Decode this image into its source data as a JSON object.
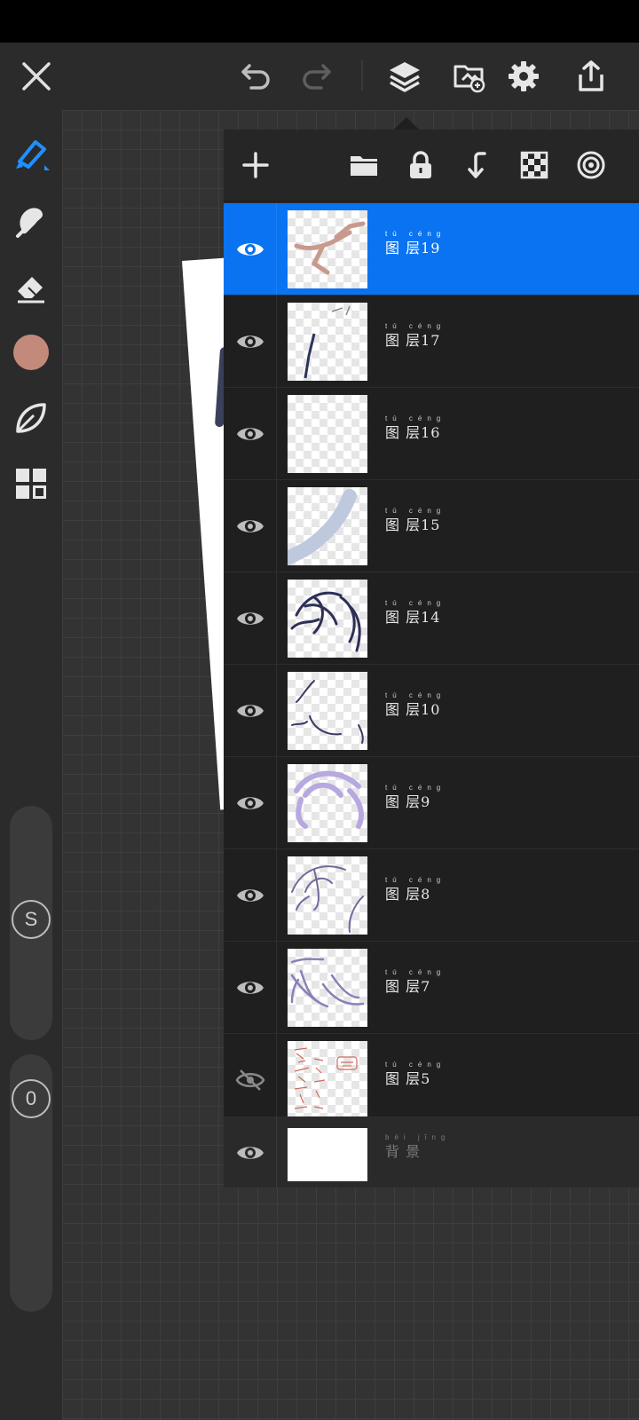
{
  "app": {
    "icons": {
      "close": "close-icon",
      "undo": "undo-icon",
      "redo": "redo-icon",
      "layers": "layers-icon",
      "import": "import-image-icon",
      "settings": "gear-icon",
      "share": "share-icon"
    }
  },
  "side_toolbar": {
    "tools": [
      "brush-icon",
      "smudge-icon",
      "eraser-icon",
      "color-swatch",
      "leaf-icon",
      "grid-icon"
    ],
    "color": "#c38a7c",
    "size_slider_label": "S",
    "opacity_slider_label": "0"
  },
  "layers_panel": {
    "toolbar": [
      "add-layer-icon",
      "folder-icon",
      "lock-icon",
      "merge-down-icon",
      "transparency-icon",
      "blend-mode-icon"
    ],
    "accent_color": "#0a73f2",
    "layers": [
      {
        "pinyin": "tú céng",
        "label": "图 层19",
        "visible": true,
        "selected": true
      },
      {
        "pinyin": "tú céng",
        "label": "图 层17",
        "visible": true,
        "selected": false
      },
      {
        "pinyin": "tú céng",
        "label": "图 层16",
        "visible": true,
        "selected": false
      },
      {
        "pinyin": "tú céng",
        "label": "图 层15",
        "visible": true,
        "selected": false
      },
      {
        "pinyin": "tú céng",
        "label": "图 层14",
        "visible": true,
        "selected": false
      },
      {
        "pinyin": "tú céng",
        "label": "图 层10",
        "visible": true,
        "selected": false
      },
      {
        "pinyin": "tú céng",
        "label": "图 层9",
        "visible": true,
        "selected": false
      },
      {
        "pinyin": "tú céng",
        "label": "图 层8",
        "visible": true,
        "selected": false
      },
      {
        "pinyin": "tú céng",
        "label": "图 层7",
        "visible": true,
        "selected": false
      },
      {
        "pinyin": "tú céng",
        "label": "图 层5",
        "visible": false,
        "selected": false
      }
    ],
    "background": {
      "pinyin": "bèi jǐng",
      "label": "背 景",
      "visible": true
    }
  }
}
